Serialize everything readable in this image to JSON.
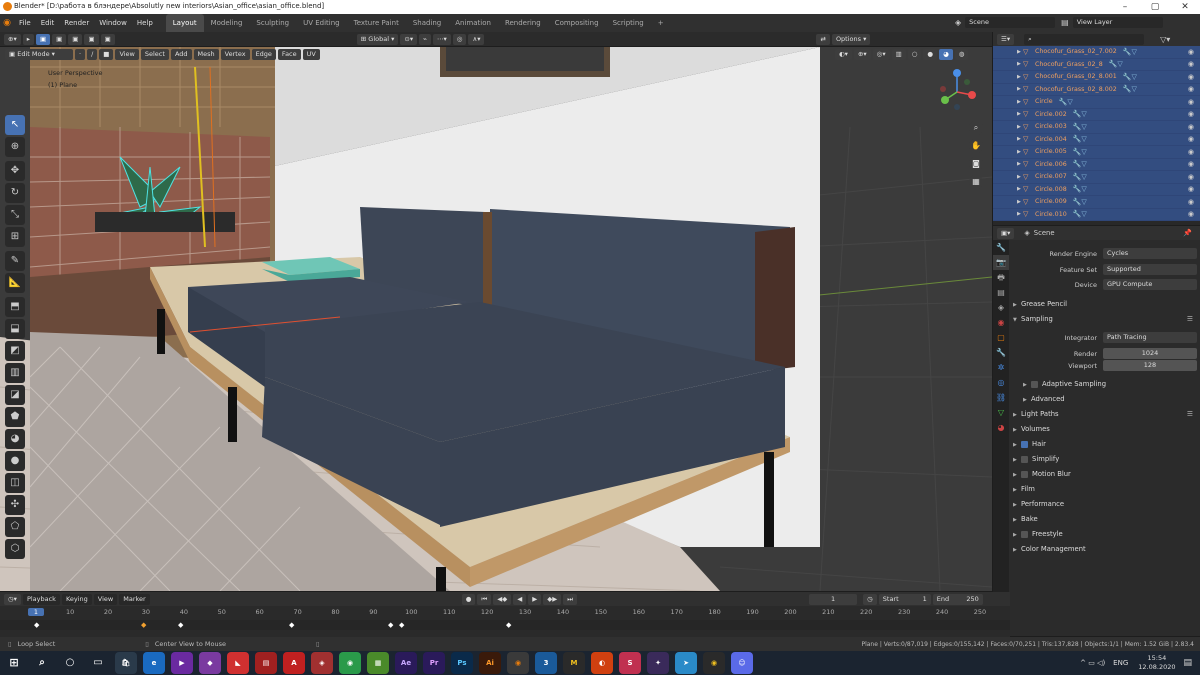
{
  "titlebar": {
    "title": "Blender* [D:\\работа в блэндере\\Absolutly new interiors\\Asian_office\\asian_office.blend]"
  },
  "menu": {
    "items": [
      "File",
      "Edit",
      "Render",
      "Window",
      "Help"
    ]
  },
  "workspaces": [
    "Layout",
    "Modeling",
    "Sculpting",
    "UV Editing",
    "Texture Paint",
    "Shading",
    "Animation",
    "Rendering",
    "Compositing",
    "Scripting"
  ],
  "scene": {
    "scene_label": "Scene",
    "view_layer_label": "View Layer"
  },
  "viewport_header": {
    "mode": "Edit Mode",
    "menus": [
      "View",
      "Select",
      "Add",
      "Mesh",
      "Vertex",
      "Edge",
      "Face",
      "UV"
    ],
    "transform": "Global",
    "options": "Options"
  },
  "viewport": {
    "perspective": "User Perspective",
    "object": "(1) Plane"
  },
  "outliner": {
    "items": [
      "Chocofur_Grass_02_7.002",
      "Chocofur_Grass_02_8",
      "Chocofur_Grass_02_8.001",
      "Chocofur_Grass_02_8.002",
      "Circle",
      "Circle.002",
      "Circle.003",
      "Circle.004",
      "Circle.005",
      "Circle.006",
      "Circle.007",
      "Circle.008",
      "Circle.009",
      "Circle.010"
    ]
  },
  "properties": {
    "scene": "Scene",
    "render_engine_label": "Render Engine",
    "render_engine": "Cycles",
    "feature_set_label": "Feature Set",
    "feature_set": "Supported",
    "device_label": "Device",
    "device": "GPU Compute",
    "grease_pencil": "Grease Pencil",
    "sampling": "Sampling",
    "integrator_label": "Integrator",
    "integrator": "Path Tracing",
    "render_label": "Render",
    "render_samples": "1024",
    "viewport_label": "Viewport",
    "viewport_samples": "128",
    "adaptive_sampling": "Adaptive Sampling",
    "advanced": "Advanced",
    "light_paths": "Light Paths",
    "volumes": "Volumes",
    "hair": "Hair",
    "simplify": "Simplify",
    "motion_blur": "Motion Blur",
    "film": "Film",
    "performance": "Performance",
    "bake": "Bake",
    "freestyle": "Freestyle",
    "color_management": "Color Management"
  },
  "timeline": {
    "menus": [
      "Playback",
      "Keying",
      "View",
      "Marker"
    ],
    "current_frame": "1",
    "start_label": "Start",
    "start": "1",
    "end_label": "End",
    "end": "250",
    "ticks": [
      "1",
      "10",
      "20",
      "30",
      "40",
      "50",
      "60",
      "70",
      "80",
      "90",
      "100",
      "110",
      "120",
      "130",
      "140",
      "150",
      "160",
      "170",
      "180",
      "190",
      "200",
      "210",
      "220",
      "230",
      "240",
      "250"
    ]
  },
  "statusbar": {
    "left1": "Loop Select",
    "left2": "Center View to Mouse",
    "stats": "Plane | Verts:0/87,019 | Edges:0/155,142 | Faces:0/70,251 | Tris:137,828 | Objects:1/1 | Mem: 1.52 GiB | 2.83.4"
  },
  "taskbar": {
    "lang": "ENG",
    "time": "15:54",
    "date": "12.08.2020"
  }
}
